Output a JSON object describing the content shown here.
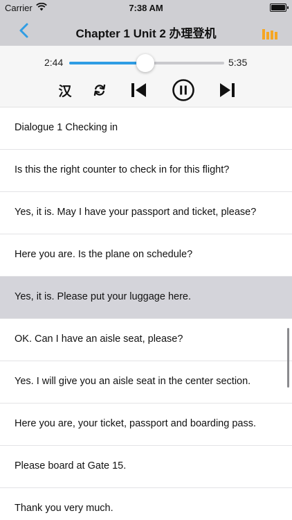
{
  "status_bar": {
    "carrier": "Carrier",
    "time": "7:38 AM"
  },
  "nav": {
    "title": "Chapter 1 Unit 2 办理登机",
    "back_icon": "chevron-left-icon",
    "menu_icon": "equalizer-icon"
  },
  "player": {
    "current_time": "2:44",
    "total_time": "5:35",
    "progress": 0.49,
    "lang_toggle": "汉",
    "colors": {
      "accent": "#2f9de4",
      "menu": "#f5a623",
      "header_bg": "#cfcfd3"
    }
  },
  "lines": [
    {
      "text": "Dialogue 1 Checking in"
    },
    {
      "text": "Is this the right counter to check in for this flight?"
    },
    {
      "text": "Yes, it is. May I have your passport and ticket, please?"
    },
    {
      "text": "Here you are. Is the plane on schedule?"
    },
    {
      "text": "Yes, it is. Please put your luggage here.",
      "selected": true
    },
    {
      "text": "OK. Can I have an aisle seat, please?"
    },
    {
      "text": "Yes. I will give you an aisle seat in the center section."
    },
    {
      "text": "Here you are, your ticket, passport and boarding pass."
    },
    {
      "text": "Please board at Gate 15."
    },
    {
      "text": "Thank you very much."
    }
  ]
}
